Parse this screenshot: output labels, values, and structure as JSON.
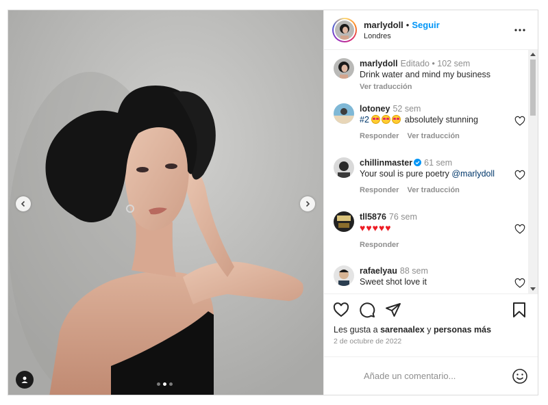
{
  "post": {
    "author": "marlydoll",
    "separator": "•",
    "follow_label": "Seguir",
    "location": "Londres",
    "caption": {
      "user": "marlydoll",
      "meta": "Editado •  102 sem",
      "text": "Drink water and mind my business",
      "translate": "Ver traducción"
    },
    "comments": [
      {
        "user": "lotoney",
        "time": "52 sem",
        "prefix": "#2",
        "text": "absolutely stunning",
        "emoji": "star-struck-emoji",
        "emoji_count": 3,
        "reply": "Responder",
        "translate": "Ver traducción"
      },
      {
        "user": "chillinmaster",
        "verified": true,
        "time": "61 sem",
        "text": "Your soul is pure poetry ",
        "mention": "@marlydoll",
        "reply": "Responder",
        "translate": "Ver traducción"
      },
      {
        "user": "tll5876",
        "time": "76 sem",
        "text": "♥♥♥♥♥",
        "reply": "Responder"
      },
      {
        "user": "rafaelyau",
        "time": "88 sem",
        "text": "Sweet shot love it"
      }
    ],
    "likes": {
      "prefix": "Les gusta a ",
      "user": "sarenaalex",
      "middle": " y ",
      "others": "personas más"
    },
    "date": "2 de octubre de 2022",
    "comment_placeholder": "Añade un comentario...",
    "carousel": {
      "count": 3,
      "active": 2
    }
  },
  "colors": {
    "link_blue": "#0095f6",
    "heart_red": "#ed1c24",
    "muted_text": "#8e8e8e"
  }
}
